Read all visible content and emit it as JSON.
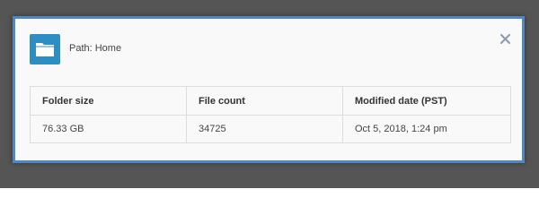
{
  "dialog": {
    "path_label": "Path: Home",
    "icons": {
      "folder": "folder-icon",
      "close": "close-icon"
    },
    "table": {
      "headers": [
        "Folder size",
        "File count",
        "Modified date (PST)"
      ],
      "row": [
        "76.33 GB",
        "34725",
        "Oct 5, 2018, 1:24 pm"
      ]
    }
  },
  "colors": {
    "border": "#4f87c6",
    "folder_icon_bg": "#2e8ec4",
    "close_icon": "#8a9bb0",
    "backdrop": "#555555"
  }
}
